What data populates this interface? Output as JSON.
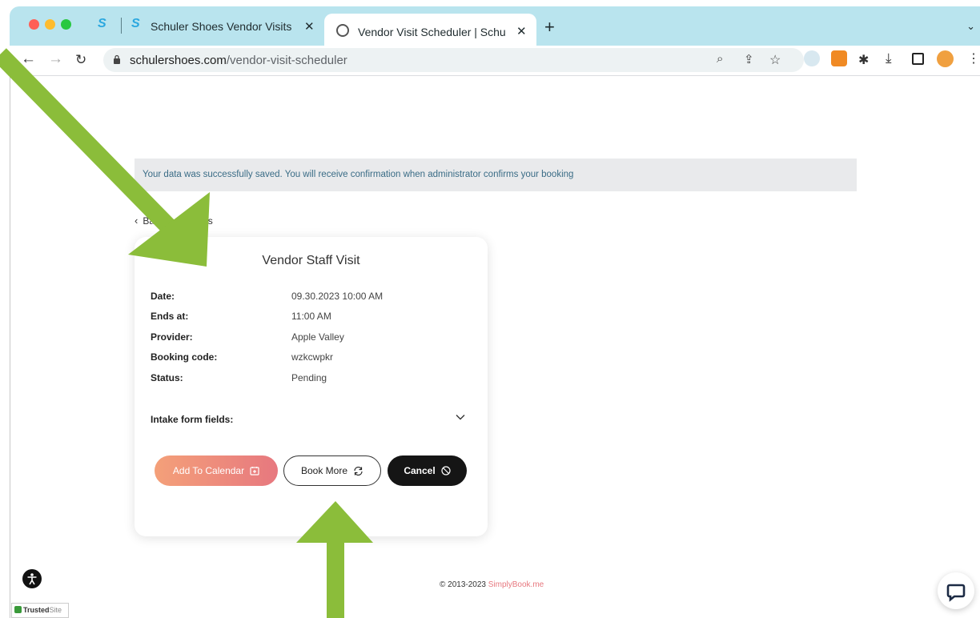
{
  "browser": {
    "tabs": [
      {
        "title": "Schuler Shoes Vendor Visits | ",
        "active": false
      },
      {
        "title": "Vendor Visit Scheduler | Schul",
        "active": true
      }
    ],
    "url_domain": "schulershoes.com",
    "url_path": "/vendor-visit-scheduler"
  },
  "page": {
    "alert_message": "Your data was successfully saved. You will receive confirmation when administrator confirms your booking",
    "back_link": "Back to services",
    "booking": {
      "title": "Vendor Staff Visit",
      "fields": [
        {
          "label": "Date:",
          "value": "09.30.2023 10:00 AM"
        },
        {
          "label": "Ends at:",
          "value": "11:00 AM"
        },
        {
          "label": "Provider:",
          "value": "Apple Valley"
        },
        {
          "label": "Booking code:",
          "value": "wzkcwpkr"
        },
        {
          "label": "Status:",
          "value": "Pending"
        }
      ],
      "intake_label": "Intake form fields:",
      "buttons": {
        "add_to_calendar": "Add To Calendar",
        "book_more": "Book More",
        "cancel": "Cancel"
      }
    },
    "footer": {
      "copyright": "© 2013-2023 ",
      "brand": "SimplyBook.me"
    },
    "trusted_badge": {
      "main": "Trusted",
      "suffix": "Site"
    }
  },
  "colors": {
    "tab_bar": "#b9e4ee",
    "alert_text": "#3a6c86",
    "calendar_button_gradient": [
      "#f4a079",
      "#e7787f"
    ],
    "cancel_button": "#151515",
    "annotation_arrow": "#8bbd3a"
  },
  "icons": [
    "back-icon",
    "forward-icon",
    "reload-icon",
    "lock-icon",
    "zoom-icon",
    "share-icon",
    "star-icon",
    "extension-icon",
    "download-icon",
    "sidepanel-icon",
    "profile-icon",
    "menu-icon",
    "calendar-icon",
    "refresh-icon",
    "cancel-icon",
    "chevron-down-icon",
    "accessibility-icon",
    "chat-icon"
  ]
}
